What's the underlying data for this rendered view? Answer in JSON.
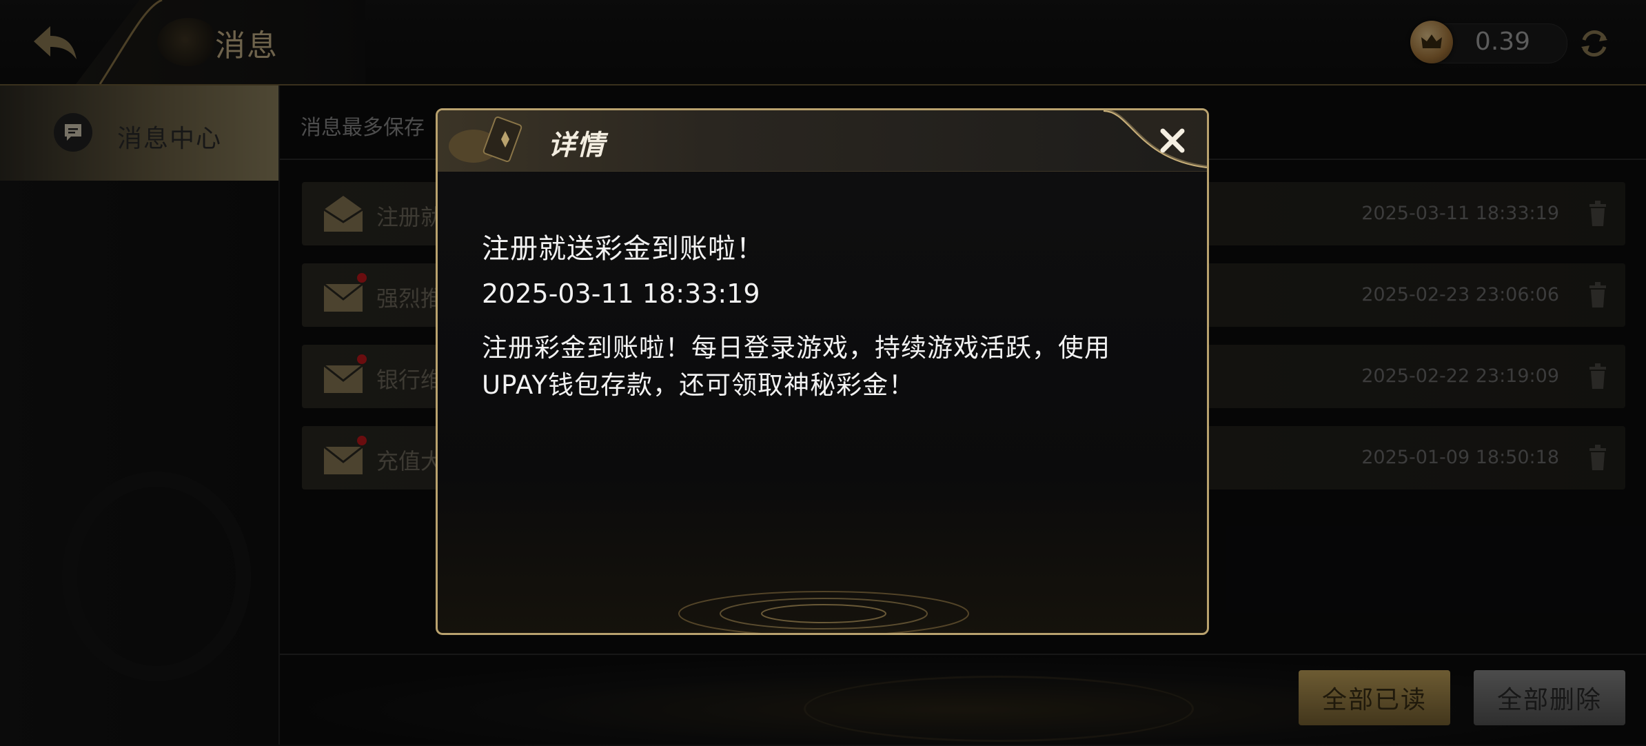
{
  "header": {
    "back_icon": "back-arrow-icon",
    "title": "消息",
    "coin_icon": "crown-coin-icon",
    "balance": "0.39",
    "refresh_icon": "refresh-icon"
  },
  "sidebar": {
    "items": [
      {
        "label": "消息中心",
        "icon": "message-icon",
        "active": true
      }
    ]
  },
  "main": {
    "notice": "消息最多保存",
    "messages": [
      {
        "title": "注册就",
        "date": "2025-03-11 18:33:19",
        "unread": false
      },
      {
        "title": "强烈推",
        "date": "2025-02-23 23:06:06",
        "unread": true
      },
      {
        "title": "银行维",
        "date": "2025-02-22 23:19:09",
        "unread": true
      },
      {
        "title": "充值大",
        "date": "2025-01-09 18:50:18",
        "unread": true
      }
    ],
    "mark_all_read": "全部已读",
    "delete_all": "全部删除"
  },
  "modal": {
    "title": "详情",
    "close_icon": "close-icon",
    "message_title": "注册就送彩金到账啦！",
    "message_date": "2025-03-11 18:33:19",
    "message_body": "注册彩金到账啦！每日登录游戏，持续游戏活跃，使用UPAY钱包存款，还可领取神秘彩金！"
  },
  "colors": {
    "accent_gold": "#b9a26e",
    "unread_dot": "#c2191d",
    "background": "#0b0b0c"
  }
}
